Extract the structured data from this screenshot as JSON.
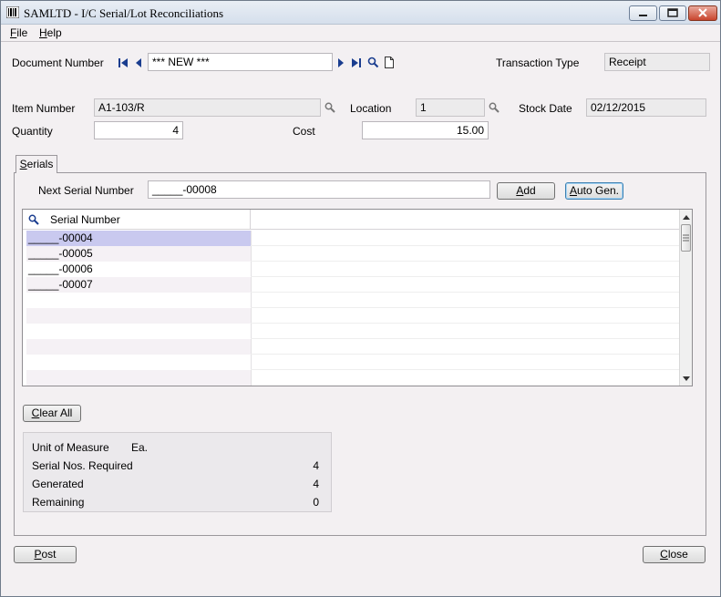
{
  "window": {
    "title": "SAMLTD - I/C Serial/Lot Reconciliations"
  },
  "menu": {
    "file_first": "F",
    "file_rest": "ile",
    "help_first": "H",
    "help_rest": "elp"
  },
  "header": {
    "document_number_label": "Document Number",
    "document_number_value": "*** NEW ***",
    "transaction_type_label": "Transaction Type",
    "transaction_type_value": "Receipt",
    "item_number_label": "Item Number",
    "item_number_value": "A1-103/R",
    "location_label": "Location",
    "location_value": "1",
    "stock_date_label": "Stock Date",
    "stock_date_value": "02/12/2015",
    "quantity_label": "Quantity",
    "quantity_value": "4",
    "cost_label": "Cost",
    "cost_value": "15.00"
  },
  "tabs": {
    "serials_first": "S",
    "serials_rest": "erials"
  },
  "serials": {
    "next_serial_label": "Next Serial Number",
    "next_serial_value": "_____-00008",
    "add_first": "A",
    "add_rest": "dd",
    "auto_gen_first": "A",
    "auto_gen_rest": "uto Gen.",
    "column_header": "Serial Number",
    "rows": [
      "_____-00004",
      "_____-00005",
      "_____-00006",
      "_____-00007"
    ],
    "clear_all_first": "C",
    "clear_all_rest": "lear All"
  },
  "summary": {
    "unit_of_measure_label": "Unit of Measure",
    "unit_of_measure_value": "Ea.",
    "serial_required_label": "Serial Nos. Required",
    "serial_required_value": "4",
    "generated_label": "Generated",
    "generated_value": "4",
    "remaining_label": "Remaining",
    "remaining_value": "0"
  },
  "footer": {
    "post_first": "P",
    "post_rest": "ost",
    "close_first": "C",
    "close_rest": "lose"
  },
  "colors": {
    "selected_row": "#c9c9ef",
    "window_bg": "#f3f0f2"
  },
  "icons": [
    "app-icon",
    "first-record-icon",
    "previous-record-icon",
    "next-record-icon",
    "last-record-icon",
    "zoom-finder-icon",
    "new-document-icon",
    "minimize-icon",
    "maximize-icon",
    "close-icon"
  ]
}
